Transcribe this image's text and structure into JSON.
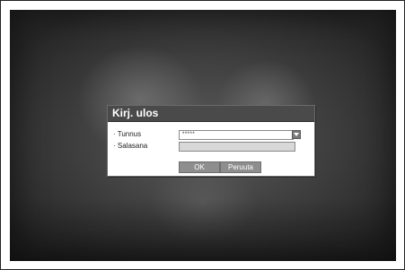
{
  "dialog": {
    "title": "Kirj. ulos",
    "fields": {
      "user": {
        "label": "· Tunnus",
        "value": "*****"
      },
      "password": {
        "label": "· Salasana",
        "value": ""
      }
    },
    "buttons": {
      "ok": "OK",
      "cancel": "Peruuta"
    }
  },
  "icons": {
    "dropdown": "chevron-down-icon"
  },
  "colors": {
    "titlebar": "#4a4a4a",
    "button": "#8e8e8e",
    "password_field": "#d8d8d8"
  }
}
